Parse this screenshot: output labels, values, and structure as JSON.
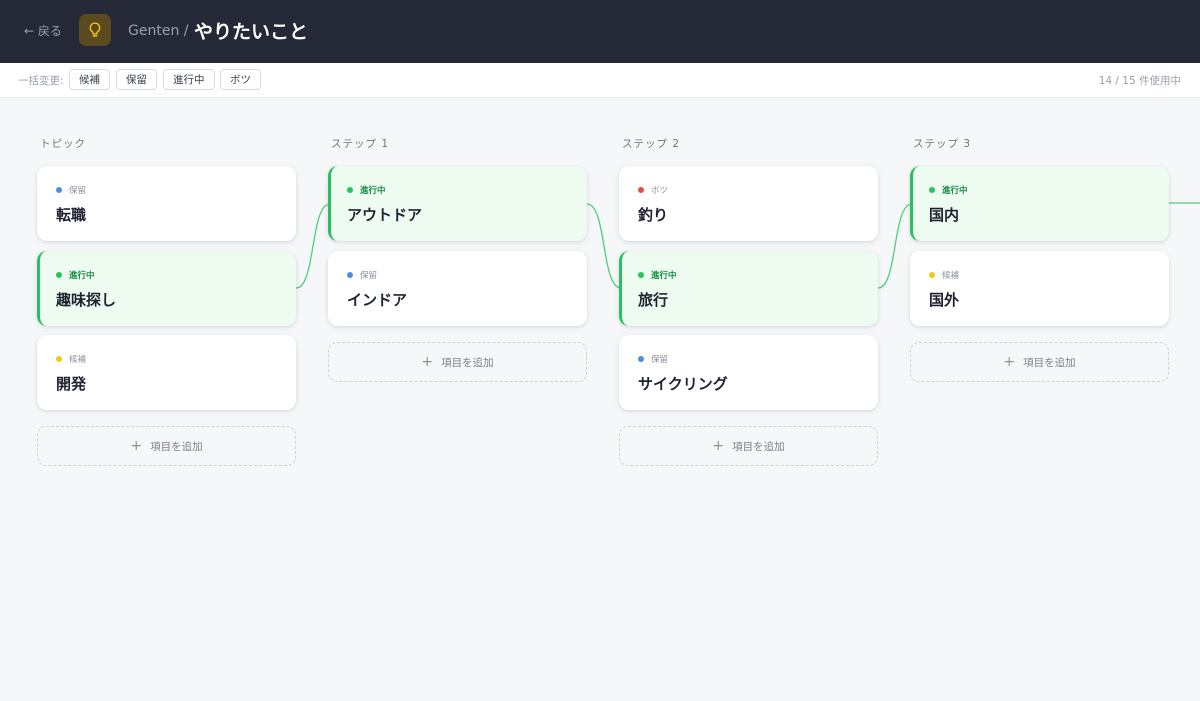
{
  "header": {
    "back_label": "← 戻る",
    "breadcrumb": "Genten /",
    "title": "やりたいこと",
    "icon": "lightbulb-icon"
  },
  "toolbar": {
    "bulk_label": "一括変更:",
    "buttons": [
      "候補",
      "保留",
      "進行中",
      "ボツ"
    ],
    "usage": "14 / 15 件使用中"
  },
  "status_colors": {
    "候補": "#f5c518",
    "保留": "#4a90e2",
    "進行中": "#22c55e",
    "ボツ": "#ef4444"
  },
  "columns": [
    {
      "title": "トピック",
      "cards": [
        {
          "status": "保留",
          "name": "転職"
        },
        {
          "status": "進行中",
          "name": "趣味探し"
        },
        {
          "status": "候補",
          "name": "開発"
        }
      ],
      "add_label": "項目を追加"
    },
    {
      "title": "ステップ 1",
      "cards": [
        {
          "status": "進行中",
          "name": "アウトドア"
        },
        {
          "status": "保留",
          "name": "インドア"
        }
      ],
      "add_label": "項目を追加"
    },
    {
      "title": "ステップ 2",
      "cards": [
        {
          "status": "ボツ",
          "name": "釣り"
        },
        {
          "status": "進行中",
          "name": "旅行"
        },
        {
          "status": "保留",
          "name": "サイクリング"
        }
      ],
      "add_label": "項目を追加"
    },
    {
      "title": "ステップ 3",
      "cards": [
        {
          "status": "進行中",
          "name": "国内"
        },
        {
          "status": "候補",
          "name": "国外"
        }
      ],
      "add_label": "項目を追加"
    }
  ]
}
